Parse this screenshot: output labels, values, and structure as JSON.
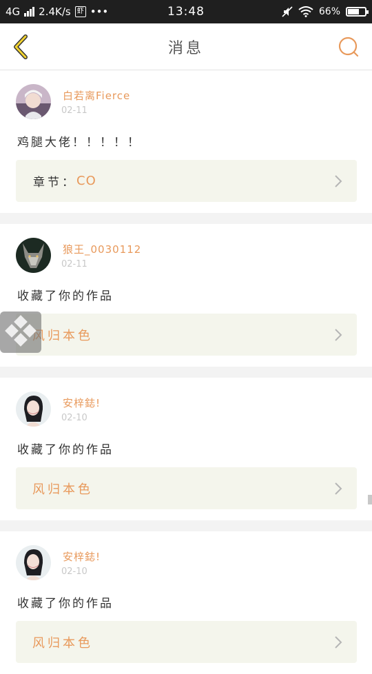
{
  "status": {
    "network": "4G",
    "speed": "2.4K/s",
    "app_badge": "虾",
    "more": "•••",
    "time": "13:48",
    "battery_percent": "66%",
    "battery_level": 0.66,
    "icons": [
      "signal-icon",
      "mute-icon",
      "wifi-icon",
      "battery-icon"
    ]
  },
  "header": {
    "title": "消息",
    "back_icon": "chevron-left-icon",
    "search_icon": "search-icon",
    "accent_color": "#e8995b"
  },
  "messages": [
    {
      "user": "白若离Fierce",
      "date": "02-11",
      "text": "鸡腿大佬！！！！！",
      "work_label": "章节：",
      "work_title": "CO"
    },
    {
      "user": "狼王_0030112",
      "date": "02-11",
      "text": "收藏了你的作品",
      "work_label": "",
      "work_title": "风归本色"
    },
    {
      "user": "安梓鋕!",
      "date": "02-10",
      "text": "收藏了你的作品",
      "work_label": "",
      "work_title": "风归本色"
    },
    {
      "user": "安梓鋕!",
      "date": "02-10",
      "text": "收藏了你的作品",
      "work_label": "",
      "work_title": "风归本色"
    }
  ]
}
